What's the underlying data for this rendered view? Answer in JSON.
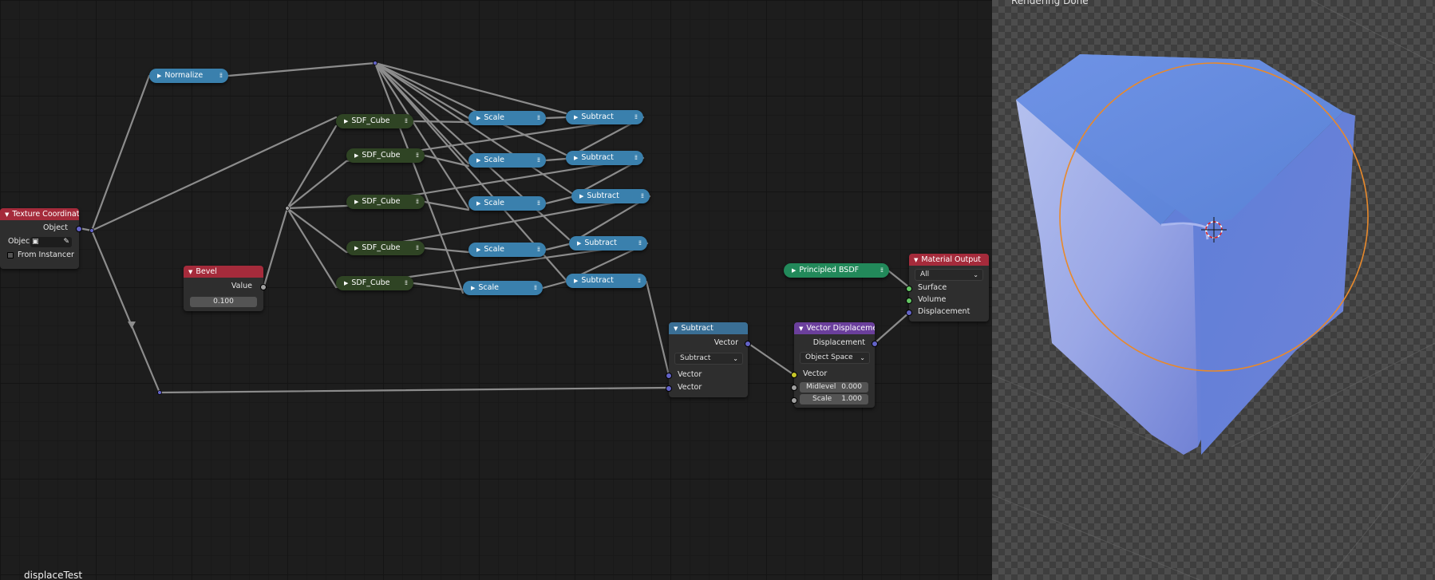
{
  "node_editor": {
    "tree_name": "displaceTest",
    "texture_coordinate": {
      "title": "Texture Coordinate",
      "output": "Object",
      "object_label": "Objec",
      "from_instancer": "From Instancer"
    },
    "bevel": {
      "title": "Bevel",
      "output": "Value",
      "value": "0.100"
    },
    "normalize": {
      "title": "Normalize"
    },
    "sdf_cubes": [
      "SDF_Cube",
      "SDF_Cube",
      "SDF_Cube",
      "SDF_Cube",
      "SDF_Cube"
    ],
    "scales": [
      "Scale",
      "Scale",
      "Scale",
      "Scale",
      "Scale"
    ],
    "subtracts": [
      "Subtract",
      "Subtract",
      "Subtract",
      "Subtract",
      "Subtract"
    ],
    "subtract_main": {
      "title": "Subtract",
      "output": "Vector",
      "operation": "Subtract",
      "input1": "Vector",
      "input2": "Vector"
    },
    "vector_displacement": {
      "title": "Vector Displacemen",
      "output": "Displacement",
      "space": "Object Space",
      "input_vector": "Vector",
      "midlevel_label": "Midlevel",
      "midlevel_value": "0.000",
      "scale_label": "Scale",
      "scale_value": "1.000"
    },
    "principled": {
      "title": "Principled BSDF"
    },
    "material_output": {
      "title": "Material Output",
      "target": "All",
      "surface": "Surface",
      "volume": "Volume",
      "displacement": "Displacement"
    }
  },
  "viewport": {
    "status": "Rendering Done"
  },
  "colors": {
    "shader_header": "#a52b3b",
    "vector_header": "#3a6f95",
    "converter_header": "#6b3f9c",
    "group_node": "#2f4424",
    "shader_node": "#22895a",
    "selection_outline": "#e8892b"
  }
}
